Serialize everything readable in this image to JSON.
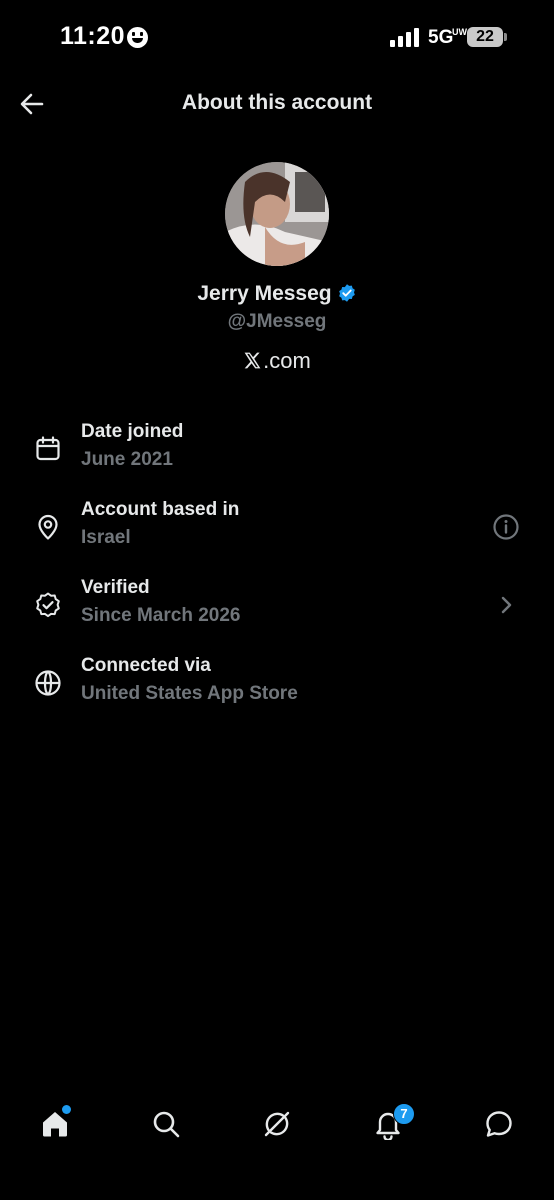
{
  "status_bar": {
    "time": "11:20",
    "network": "5G",
    "network_sub": "UW",
    "battery": "22"
  },
  "header": {
    "title": "About this account"
  },
  "profile": {
    "display_name": "Jerry Messeg",
    "username": "@JMesseg",
    "platform": ".com"
  },
  "info": [
    {
      "label": "Date joined",
      "value": "June 2021",
      "icon": "calendar-icon"
    },
    {
      "label": "Account based in",
      "value": "Israel",
      "icon": "location-pin-icon",
      "trailing_icon": "info-icon"
    },
    {
      "label": "Verified",
      "value": "Since March 2026",
      "icon": "verified-badge-icon",
      "trailing_icon": "chevron-right-icon"
    },
    {
      "label": "Connected via",
      "value": "United States App Store",
      "icon": "globe-icon"
    }
  ],
  "bottom_nav": {
    "items": [
      "home-icon",
      "search-icon",
      "grok-icon",
      "notifications-icon",
      "messages-icon"
    ],
    "notification_count": "7"
  },
  "colors": {
    "background": "#000000",
    "primary_text": "#e7e9ea",
    "secondary_text": "#71767b",
    "accent": "#1d9bf0"
  }
}
